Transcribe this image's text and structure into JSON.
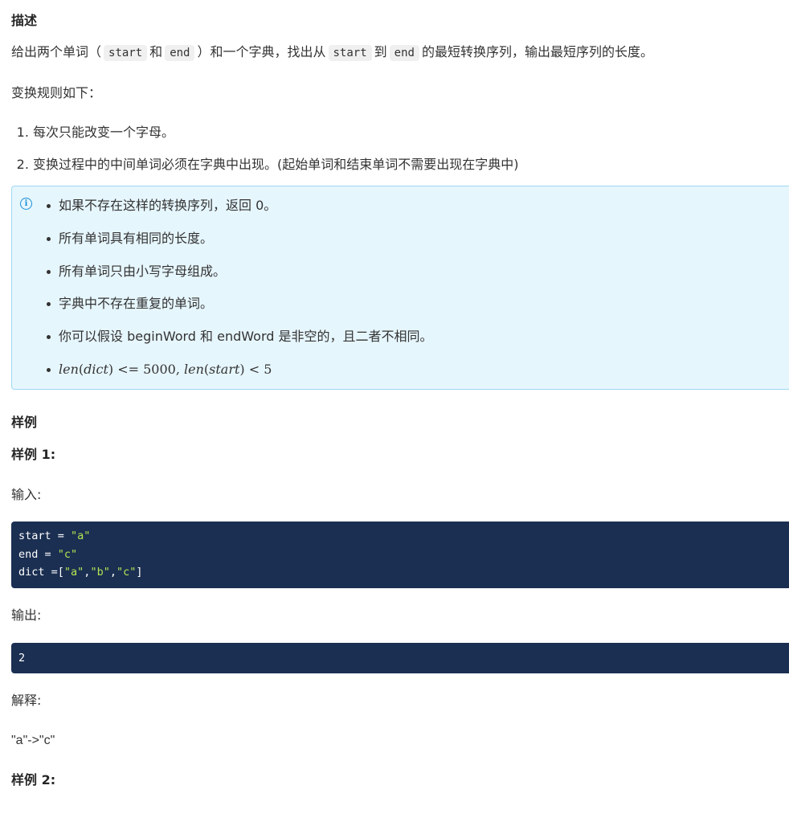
{
  "description": {
    "heading": "描述",
    "intro_prefix": "给出两个单词（",
    "code_start": "start",
    "intro_and": "和",
    "code_end": "end",
    "intro_middle": "）和一个字典，找出从",
    "code_start_2": "start",
    "intro_to": "到",
    "code_end_2": "end",
    "intro_suffix": "的最短转换序列，输出最短序列的长度。",
    "rules_label": "变换规则如下：",
    "rules": [
      "每次只能改变一个字母。",
      "变换过程中的中间单词必须在字典中出现。(起始单词和结束单词不需要出现在字典中)"
    ]
  },
  "notice": {
    "icon": "info-icon",
    "items": [
      "如果不存在这样的转换序列，返回 0。",
      "所有单词具有相同的长度。",
      "所有单词只由小写字母组成。",
      "字典中不存在重复的单词。",
      "你可以假设 beginWord 和 endWord 是非空的，且二者不相同。"
    ],
    "math": {
      "len1": "len",
      "dict": "dict",
      "op1": "<=",
      "num1": "5000",
      "len2": "len",
      "start": "start",
      "op2": "<",
      "num2": "5"
    }
  },
  "examples": {
    "heading": "样例",
    "example1_heading": "样例 1:",
    "input_label": "输入:",
    "input_code": {
      "line1_key": "start = ",
      "line1_val": "\"a\"",
      "line2_key": "end = ",
      "line2_val": "\"c\"",
      "line3_key": "dict =[",
      "line3_v1": "\"a\"",
      "line3_c1": ",",
      "line3_v2": "\"b\"",
      "line3_c2": ",",
      "line3_v3": "\"c\"",
      "line3_end": "]"
    },
    "output_label": "输出:",
    "output_code": "2",
    "explain_label": "解释:",
    "explain_text": "\"a\"->\"c\"",
    "example2_heading": "样例 2:"
  },
  "colors": {
    "code_bg": "#1b2f52",
    "string_green": "#b3e453",
    "notice_bg": "#e6f6fd",
    "notice_border": "#9fd8f2",
    "info_blue": "#1b8fd9"
  }
}
